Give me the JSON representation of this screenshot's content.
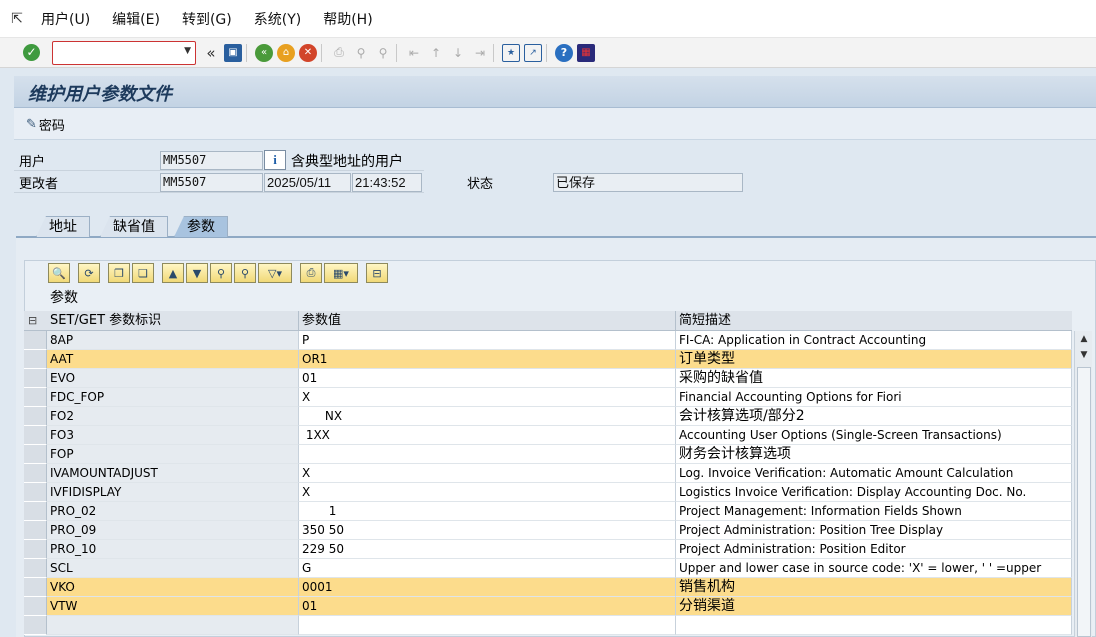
{
  "menu": {
    "items": [
      "用户(U)",
      "编辑(E)",
      "转到(G)",
      "系统(Y)",
      "帮助(H)"
    ]
  },
  "toolbar": {
    "command_value": "",
    "icons": [
      "save-icon",
      "back-icon",
      "exit-icon",
      "cancel-icon",
      "print-icon",
      "find-icon",
      "find-next-icon",
      "first-page-icon",
      "previous-page-icon",
      "next-page-icon",
      "last-page-icon",
      "new-session-icon",
      "shortcut-icon",
      "help-icon",
      "customize-layout-icon"
    ]
  },
  "title": "维护用户参数文件",
  "appbar": {
    "password_label": "密码"
  },
  "header": {
    "user_label": "用户",
    "user_value": "MM5507",
    "user_desc": "含典型地址的用户",
    "changed_by_label": "更改者",
    "changed_by_value": "MM5507",
    "changed_date": "2025/05/11",
    "changed_time": "21:43:52",
    "status_label": "状态",
    "status_value": "已保存"
  },
  "tabs": [
    "地址",
    "缺省值",
    "参数"
  ],
  "active_tab": "参数",
  "grid": {
    "title": "参数",
    "columns": [
      "SET/GET 参数标识",
      "参数值",
      "简短描述"
    ],
    "rows": [
      {
        "id": "8AP",
        "value": "P",
        "desc": "FI-CA: Application in Contract Accounting",
        "hl": false
      },
      {
        "id": "AAT",
        "value": "OR1",
        "desc": "订单类型",
        "hl": true
      },
      {
        "id": "EVO",
        "value": "01",
        "desc": "采购的缺省值",
        "hl": false
      },
      {
        "id": "FDC_FOP",
        "value": "X",
        "desc": "Financial Accounting Options for Fiori",
        "hl": false
      },
      {
        "id": "FO2",
        "value": "      NX",
        "desc": "会计核算选项/部分2",
        "hl": false
      },
      {
        "id": "FO3",
        "value": " 1XX",
        "desc": "Accounting User Options (Single-Screen Transactions)",
        "hl": false
      },
      {
        "id": "FOP",
        "value": "",
        "desc": "财务会计核算选项",
        "hl": false
      },
      {
        "id": "IVAMOUNTADJUST",
        "value": "X",
        "desc": "Log. Invoice Verification: Automatic Amount Calculation",
        "hl": false
      },
      {
        "id": "IVFIDISPLAY",
        "value": "X",
        "desc": "Logistics Invoice Verification: Display Accounting Doc. No.",
        "hl": false
      },
      {
        "id": "PRO_02",
        "value": "       1",
        "desc": "Project Management: Information Fields Shown",
        "hl": false
      },
      {
        "id": "PRO_09",
        "value": "350 50",
        "desc": "Project Administration: Position Tree Display",
        "hl": false
      },
      {
        "id": "PRO_10",
        "value": "229 50",
        "desc": "Project Administration: Position Editor",
        "hl": false
      },
      {
        "id": "SCL",
        "value": "G",
        "desc": "Upper and lower case in source code: 'X' = lower, ' ' =upper",
        "hl": false
      },
      {
        "id": "VKO",
        "value": "0001",
        "desc": "销售机构",
        "hl": true
      },
      {
        "id": "VTW",
        "value": "01",
        "desc": "分销渠道",
        "hl": true
      },
      {
        "id": "",
        "value": "",
        "desc": "",
        "hl": false
      }
    ]
  }
}
